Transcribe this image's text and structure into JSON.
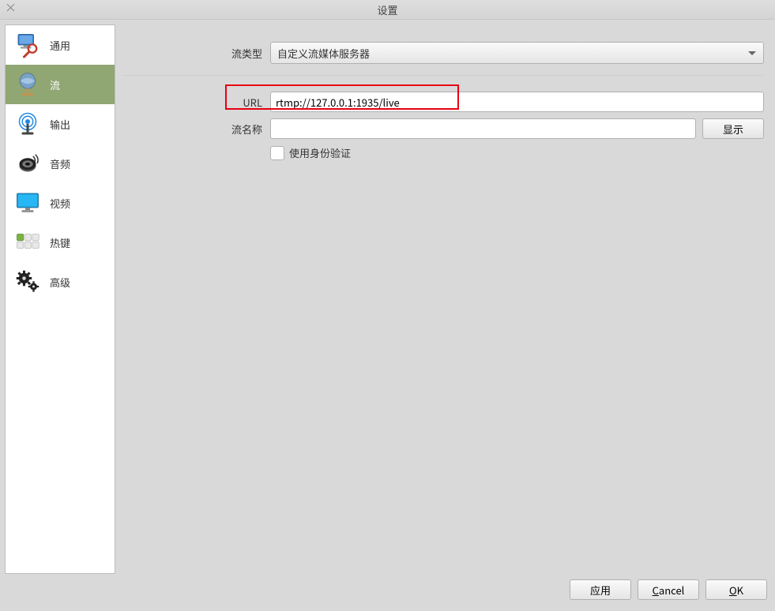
{
  "window": {
    "title": "设置",
    "close_glyph": "×"
  },
  "sidebar": {
    "items": [
      {
        "label": "通用"
      },
      {
        "label": "流"
      },
      {
        "label": "输出"
      },
      {
        "label": "音频"
      },
      {
        "label": "视频"
      },
      {
        "label": "热键"
      },
      {
        "label": "高级"
      }
    ],
    "selected_index": 1
  },
  "form": {
    "stream_type_label": "流类型",
    "stream_type_value": "自定义流媒体服务器",
    "url_label": "URL",
    "url_value": "rtmp://127.0.0.1:1935/live",
    "stream_name_label": "流名称",
    "stream_name_value": "",
    "show_button": "显示",
    "use_auth_label": "使用身份验证",
    "use_auth_checked": false
  },
  "footer": {
    "apply": "应用",
    "cancel_full": "Cancel",
    "cancel_u": "C",
    "cancel_rest": "ancel",
    "ok_full": "OK",
    "ok_u": "O",
    "ok_rest": "K"
  }
}
